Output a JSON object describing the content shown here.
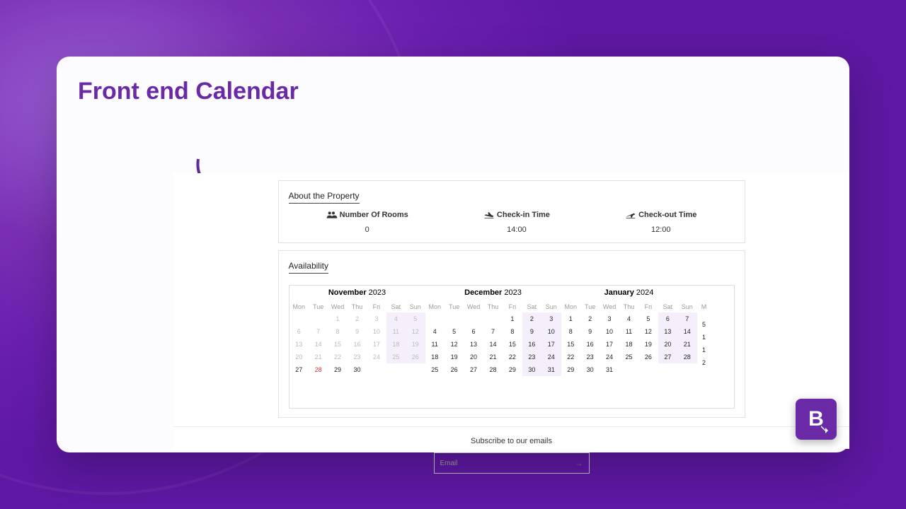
{
  "title": "Front end Calendar",
  "property": {
    "heading": "About the Property",
    "rooms_label": "Number Of Rooms",
    "rooms_value": "0",
    "checkin_label": "Check-in Time",
    "checkin_value": "14:00",
    "checkout_label": "Check-out Time",
    "checkout_value": "12:00"
  },
  "availability": {
    "heading": "Availability",
    "dow": [
      "Mon",
      "Tue",
      "Wed",
      "Thu",
      "Fri",
      "Sat",
      "Sun"
    ],
    "months": [
      {
        "name": "November",
        "year": "2023",
        "lead": 2,
        "days": 30,
        "trail": 0,
        "today": 28,
        "muted_until": 26
      },
      {
        "name": "December",
        "year": "2023",
        "lead": 4,
        "days": 31,
        "trail": 0,
        "today": 0,
        "muted_until": 0
      },
      {
        "name": "January",
        "year": "2024",
        "lead": 0,
        "days": 31,
        "trail": 0,
        "today": 0,
        "muted_until": 0
      }
    ],
    "partial_dow": "M",
    "partial_days": [
      "",
      "5",
      "1",
      "1",
      "2"
    ]
  },
  "footer": {
    "subscribe": "Subscribe to our emails",
    "placeholder": "Email"
  },
  "badge": "B"
}
